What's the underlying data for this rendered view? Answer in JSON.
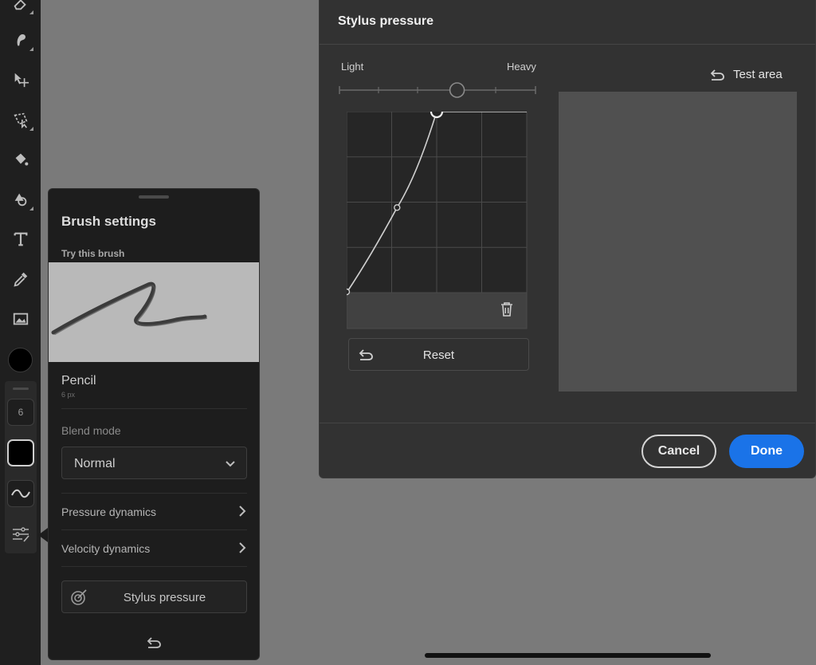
{
  "toolbar": {
    "tools": [
      "eraser-icon",
      "smudge-icon",
      "move-icon",
      "lasso-icon",
      "fill-icon",
      "shape-icon",
      "text-icon",
      "eyedropper-icon",
      "image-icon"
    ],
    "color_swatch": "#000000",
    "brush_size": "6"
  },
  "brush_panel": {
    "title": "Brush settings",
    "try_label": "Try this brush",
    "brush_name": "Pencil",
    "brush_size": "6 px",
    "blend_label": "Blend mode",
    "blend_value": "Normal",
    "pressure_dynamics": "Pressure dynamics",
    "velocity_dynamics": "Velocity dynamics",
    "stylus_pressure": "Stylus pressure"
  },
  "dialog": {
    "title": "Stylus pressure",
    "light_label": "Light",
    "heavy_label": "Heavy",
    "slider_value": 0.6,
    "curve_points": [
      [
        0,
        0
      ],
      [
        0.28,
        0.47
      ],
      [
        0.5,
        1.0
      ],
      [
        1.0,
        1.0
      ]
    ],
    "reset_label": "Reset",
    "test_area_label": "Test area",
    "cancel_label": "Cancel",
    "done_label": "Done",
    "accent_color": "#1a73e8"
  }
}
